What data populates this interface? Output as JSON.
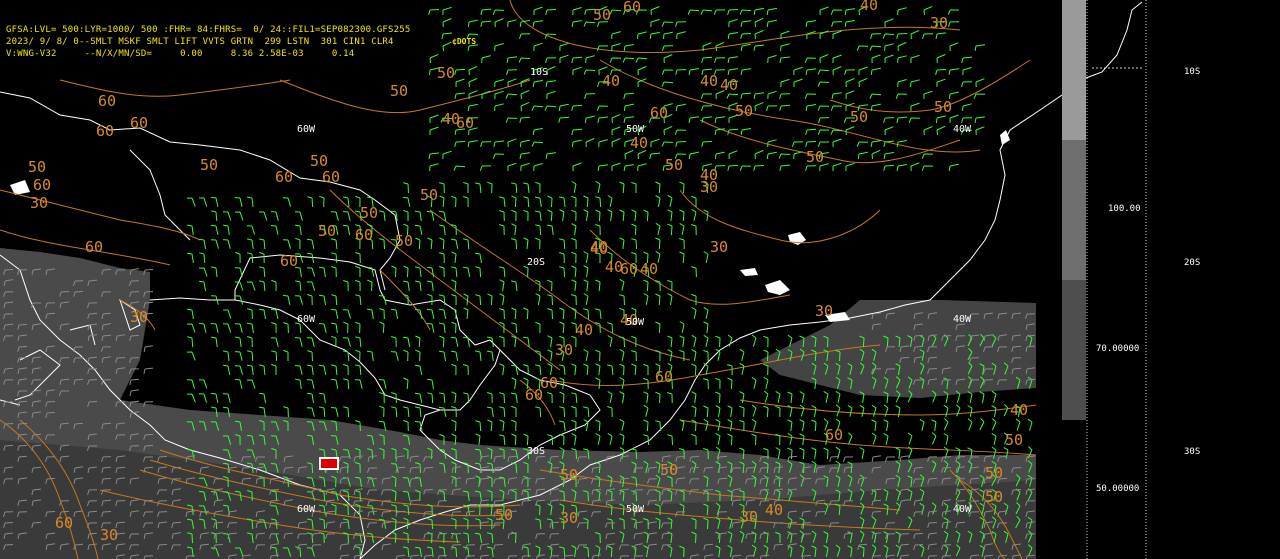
{
  "header": {
    "line1": "GFSA:LVL= 500:LYR=1000/ 500 :FHR= 84:FHRS=  0/ 24::FIL1=SEP082300.GFS255",
    "line2": "2023/ 9/ 8/ 0--SMLT MSKF SMLT LIFT VVTS GRTN  299 LSTN  301 CIN1 CLR4",
    "line3": "V:WNG-V32     --N/X/MN/SD=     0.00     8.36 2.58E-03     0.14",
    "tag": "¢DOTS"
  },
  "grid_labels": {
    "lon_60w_a": "60W",
    "lon_50w_a": "50W",
    "lon_40w_a": "40W",
    "lat_10s": "10S",
    "lat_20s": "20S",
    "lon_60w_b": "60W",
    "lon_50w_b": "50W",
    "lon_40w_b": "40W",
    "lat_30s": "30S",
    "lon_60w_c": "60W",
    "lon_50w_c": "50W",
    "lon_40w_c": "40W"
  },
  "contour_labels": [
    "50",
    "60",
    "40",
    "30",
    "50",
    "40",
    "40",
    "40",
    "60",
    "60",
    "60",
    "50",
    "50",
    "50",
    "50",
    "40",
    "60",
    "60",
    "60",
    "60",
    "30",
    "50",
    "50",
    "40",
    "60",
    "30",
    "40",
    "60",
    "50",
    "50",
    "50",
    "50",
    "50",
    "40",
    "40",
    "60",
    "50",
    "60",
    "50",
    "30",
    "40",
    "30",
    "40",
    "60",
    "30",
    "40",
    "40",
    "30",
    "60",
    "60",
    "60",
    "40",
    "50",
    "60",
    "50",
    "50",
    "50",
    "30",
    "30",
    "50",
    "60",
    "30",
    "50",
    "40"
  ],
  "legend": {
    "right_labels": {
      "lat_10s": "10S",
      "lat_20s": "20S",
      "lat_30s": "30S"
    },
    "scale_values": {
      "v1": "100.00",
      "v2": "70.00000",
      "v3": "50.00000"
    }
  },
  "colors": {
    "background": "#000000",
    "coast": "#ffffff",
    "contour": "#c8781e",
    "barb": "#33ff33",
    "shade_light": "#4a4a4a",
    "shade_mid": "#3a3a3a",
    "header_text": "#f2e600",
    "marker": "#e00000"
  }
}
